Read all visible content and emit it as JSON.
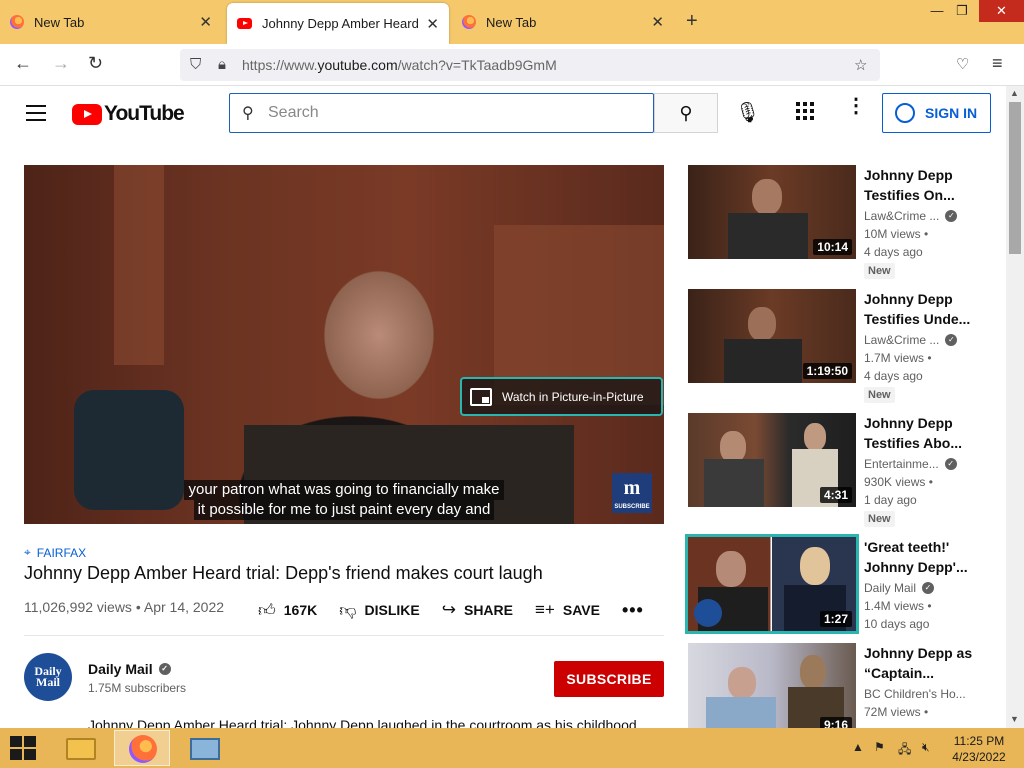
{
  "browser": {
    "tabs": [
      {
        "title": "New Tab",
        "icon": "firefox-icon"
      },
      {
        "title": "Johnny Depp Amber Heard trial",
        "icon": "youtube-icon"
      },
      {
        "title": "New Tab",
        "icon": "firefox-icon"
      }
    ],
    "url_prefix": "https://www.",
    "url_domain": "youtube.com",
    "url_path": "/watch?v=TkTaadb9GmM"
  },
  "yt": {
    "logo_text": "YouTube",
    "search_placeholder": "Search",
    "signin_label": "SIGN IN"
  },
  "video": {
    "caption_line1": "your patron what was going to financially make",
    "caption_line2": "it possible for me to just paint every day and",
    "pip_label": "Watch in Picture-in-Picture",
    "badge_letter": "m",
    "badge_text": "SUBSCRIBE",
    "hashtag": "FAIRFAX",
    "title": "Johnny Depp Amber Heard trial: Depp's friend makes court laugh",
    "views": "11,026,992 views",
    "date": "Apr 14, 2022",
    "likes": "167K",
    "dislike_label": "DISLIKE",
    "share_label": "SHARE",
    "save_label": "SAVE"
  },
  "channel": {
    "avatar_line1": "Daily",
    "avatar_line2": "Mail",
    "name": "Daily Mail",
    "subscribers": "1.75M subscribers",
    "subscribe_label": "SUBSCRIBE",
    "description": "Johnny Depp Amber Heard trial: Johnny Depp laughed in the courtroom as his childhood"
  },
  "recommendations": [
    {
      "title": "Johnny Depp Testifies On...",
      "channel": "Law&Crime ...",
      "views": "10M views",
      "age": "4 days ago",
      "badge": "New",
      "duration": "10:14"
    },
    {
      "title": "Johnny Depp Testifies Unde...",
      "channel": "Law&Crime ...",
      "views": "1.7M views",
      "age": "4 days ago",
      "badge": "New",
      "duration": "1:19:50"
    },
    {
      "title": "Johnny Depp Testifies Abo...",
      "channel": "Entertainme...",
      "views": "930K views",
      "age": "1 day ago",
      "badge": "New",
      "duration": "4:31"
    },
    {
      "title": "'Great teeth!' Johnny Depp'...",
      "channel": "Daily Mail",
      "views": "1.4M views",
      "age": "10 days ago",
      "badge": "",
      "duration": "1:27"
    },
    {
      "title": "Johnny Depp as “Captain...",
      "channel": "BC Children's Ho...",
      "views": "72M views",
      "age": "",
      "badge": "",
      "duration": "9:16"
    }
  ],
  "taskbar": {
    "time": "11:25 PM",
    "date": "4/23/2022"
  },
  "colors": {
    "tabstrip": "#f5c96b",
    "taskbar": "#e8b657",
    "youtube_red": "#ff0000",
    "subscribe_red": "#cc0000",
    "link_blue": "#065fd4",
    "pip_border": "#2bb5b0"
  }
}
